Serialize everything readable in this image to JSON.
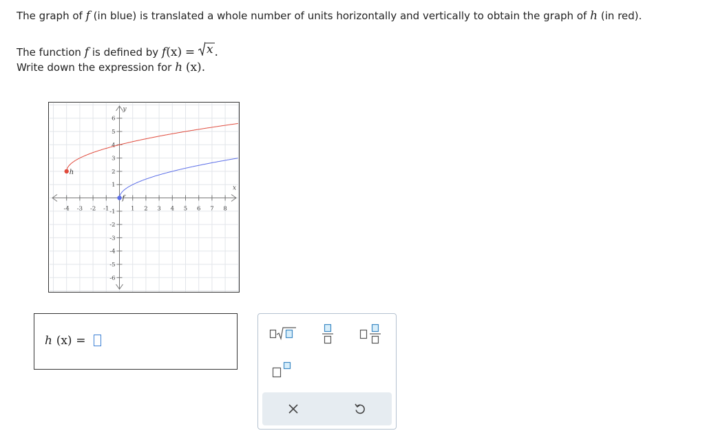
{
  "question": {
    "line1_pre": "The graph of",
    "line1_f": "f",
    "line1_mid": "(in blue) is translated a whole number of units horizontally and vertically to obtain the graph of",
    "line1_h": "h",
    "line1_post": "(in red).",
    "line2_pre": "The function",
    "line2_f": "f",
    "line2_mid": "is defined by",
    "line2_fx": "f",
    "line2_arg": "(x)",
    "line2_eq": "=",
    "line2_rad": "x",
    "line2_end": ".",
    "line3_pre": "Write down the expression for",
    "line3_h": "h",
    "line3_arg": "(x)",
    "line3_end": "."
  },
  "graph": {
    "x_axis_label": "x",
    "y_axis_label": "y",
    "x_ticks": [
      "-4",
      "-3",
      "-2",
      "-1",
      "1",
      "2",
      "3",
      "4",
      "5",
      "6",
      "7",
      "8"
    ],
    "y_ticks": [
      "6",
      "5",
      "4",
      "3",
      "2",
      "1",
      "-1",
      "-2",
      "-3",
      "-4",
      "-5",
      "-6"
    ],
    "f_label": "f",
    "h_label": "h",
    "f_color": "#5b6ee8",
    "h_color": "#e04a3c",
    "x_range": [
      -5,
      9
    ],
    "y_range": [
      -7,
      7
    ]
  },
  "chart_data": {
    "type": "line",
    "xlabel": "x",
    "ylabel": "y",
    "xlim": [
      -5,
      9
    ],
    "ylim": [
      -7,
      7
    ],
    "grid": true,
    "series": [
      {
        "name": "f",
        "x": [
          0,
          1,
          4,
          9
        ],
        "y": [
          0,
          1,
          2,
          3
        ],
        "color": "#5b6ee8",
        "start_point": [
          0,
          0
        ]
      },
      {
        "name": "h",
        "x": [
          -4,
          -3,
          0,
          5
        ],
        "y": [
          2,
          3,
          4,
          5
        ],
        "color": "#e04a3c",
        "start_point": [
          -4,
          2
        ]
      }
    ]
  },
  "answer": {
    "fn": "h",
    "arg": "(x)",
    "eq": "="
  },
  "palette": {
    "sqrt_tool": "square-root",
    "fraction_tool": "fraction",
    "mixed_number_tool": "mixed-number",
    "exponent_tool": "exponent",
    "clear_tool": "clear",
    "undo_tool": "undo"
  }
}
